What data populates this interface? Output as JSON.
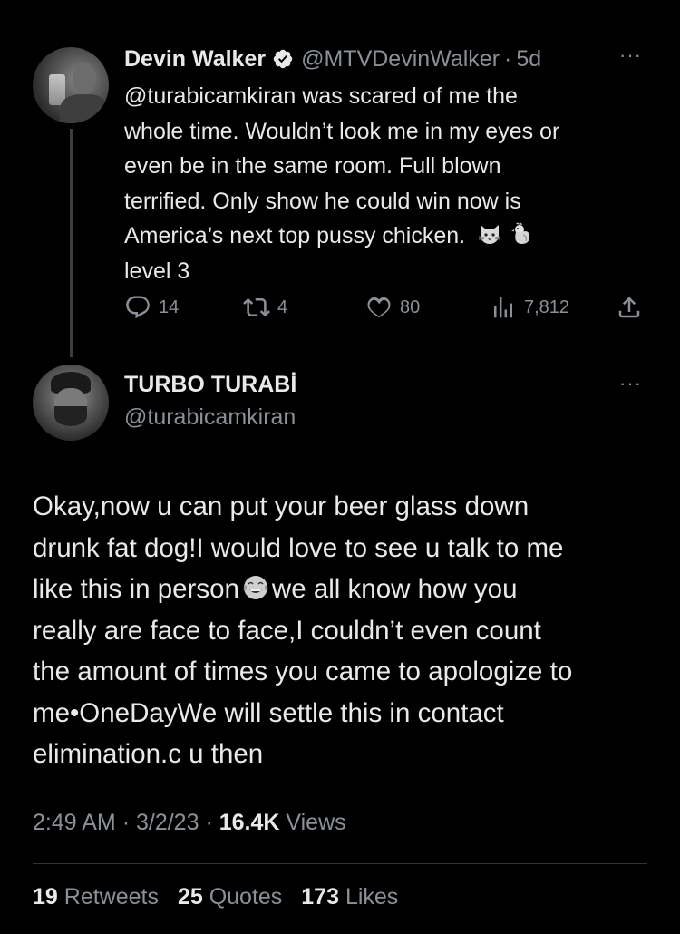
{
  "parent_tweet": {
    "author_name": "Devin Walker",
    "handle": "@MTVDevinWalker",
    "separator": "·",
    "age": "5d",
    "more_label": "···",
    "mention": "@turabicamkiran",
    "text_lines": [
      " was scared of me the",
      "whole time. Wouldn’t look me in my eyes or",
      "even be in the same room. Full blown",
      "terrified. Only show he could win now is",
      "America’s next top pussy chicken.",
      "level 3"
    ],
    "emojis": [
      "cat-face-icon",
      "chicken-icon"
    ],
    "actions": {
      "replies": "14",
      "retweets": "4",
      "likes": "80",
      "views": "7,812"
    }
  },
  "main_tweet": {
    "author_name": "TURBO TURABİ",
    "handle": "@turabicamkiran",
    "more_label": "···",
    "text_lines": [
      "Okay,now u can put your beer glass down",
      "drunk fat dog!I would love to see u talk to me",
      "like this in person",
      "we all know how you",
      "really are face to face,I couldn’t even count",
      "the amount of times you came to apologize to",
      "me•OneDayWe will settle this in contact",
      "elimination.c u then"
    ],
    "emoji": "tears-of-joy-icon",
    "time": "2:49 AM",
    "date": "3/2/23",
    "views_count": "16.4K",
    "views_label": "Views",
    "retweets_count": "19",
    "retweets_label": "Retweets",
    "quotes_count": "25",
    "quotes_label": "Quotes",
    "likes_count": "173",
    "likes_label": "Likes"
  }
}
